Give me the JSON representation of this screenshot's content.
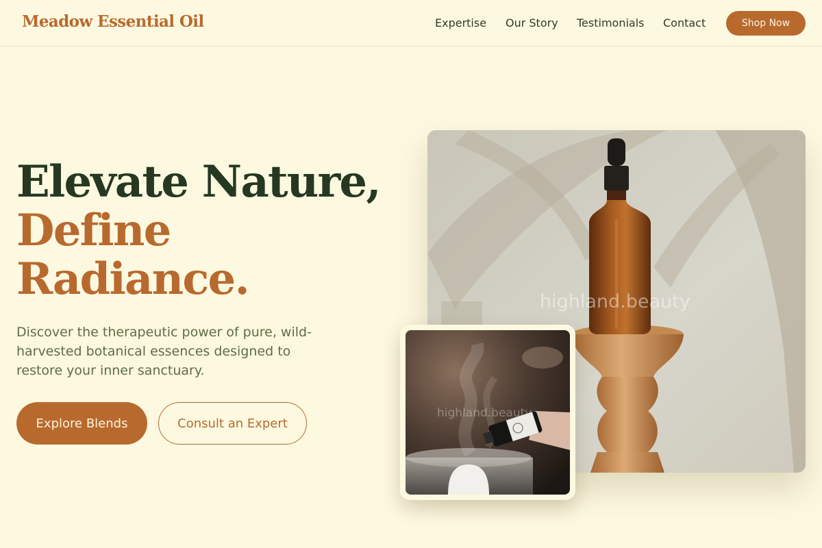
{
  "brand": {
    "name": "Meadow Essential Oil"
  },
  "nav": {
    "items": [
      "Expertise",
      "Our Story",
      "Testimonials",
      "Contact"
    ],
    "cta": "Shop Now"
  },
  "hero": {
    "title_line1": "Elevate Nature,",
    "title_line2": "Define",
    "title_line3": "Radiance.",
    "subtitle": "Discover the therapeutic power of pure, wild-harvested botanical essences designed to restore your inner sanctuary.",
    "primary_button": "Explore Blends",
    "secondary_button": "Consult an Expert"
  },
  "images": {
    "main_watermark": "highland.beauty",
    "inset_watermark": "highland.beauty"
  },
  "colors": {
    "background": "#fdf8e0",
    "accent": "#b86a2e",
    "heading_dark": "#263821",
    "body_text": "#5e6e46"
  }
}
